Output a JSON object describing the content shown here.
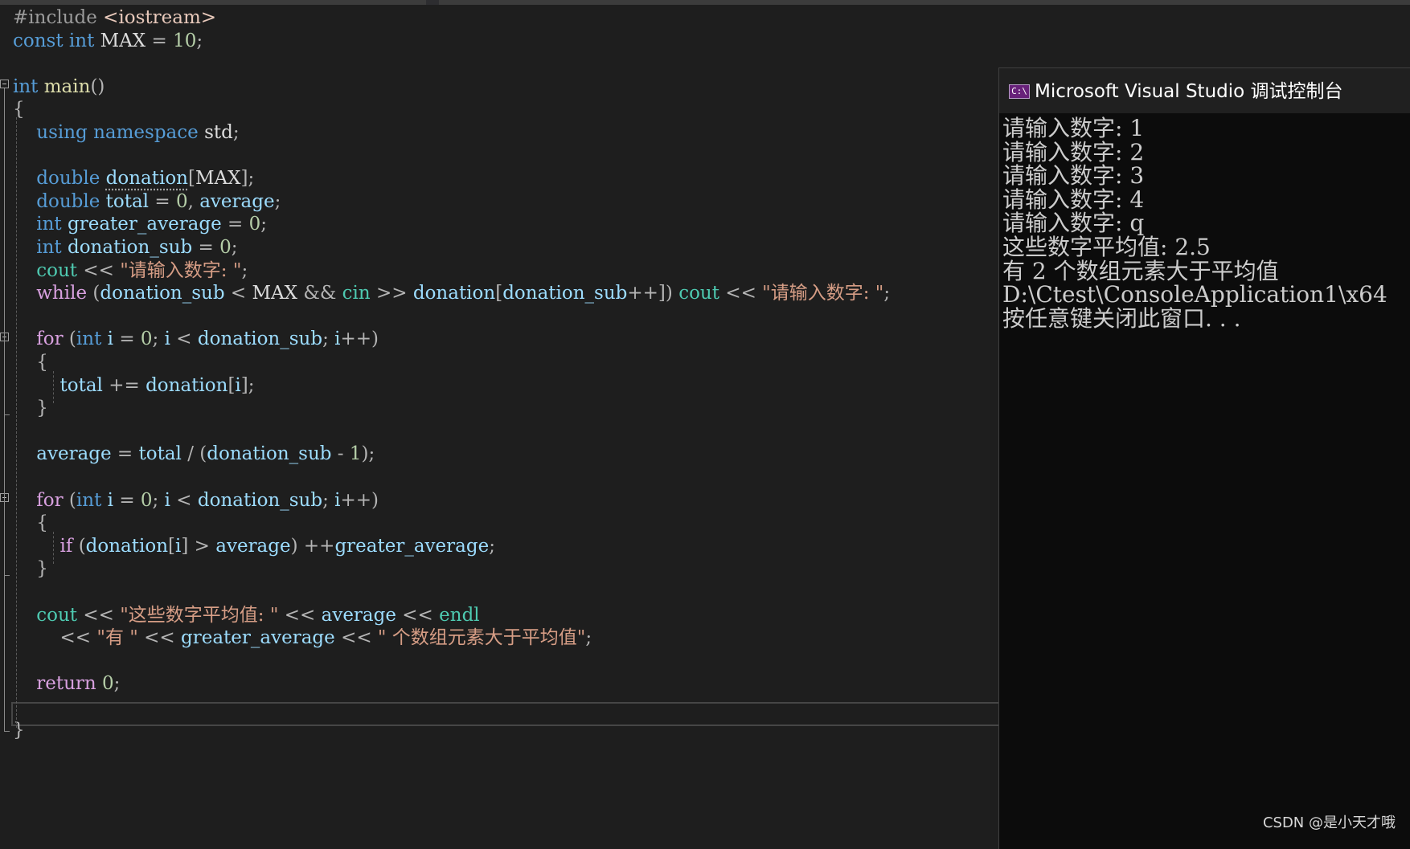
{
  "code": [
    [
      [
        "pp",
        "#include "
      ],
      [
        "inc",
        "<iostream>"
      ]
    ],
    [
      [
        "kw",
        "const "
      ],
      [
        "ty",
        "int "
      ],
      [
        "id",
        "MAX "
      ],
      [
        "op",
        "= "
      ],
      [
        "num",
        "10"
      ],
      [
        "op",
        ";"
      ]
    ],
    [],
    [
      [
        "ty",
        "int "
      ],
      [
        "fn",
        "main"
      ],
      [
        "op",
        "()"
      ]
    ],
    [
      [
        "op",
        "{"
      ]
    ],
    [
      [
        "id",
        "    "
      ],
      [
        "kw",
        "using "
      ],
      [
        "kw",
        "namespace "
      ],
      [
        "id",
        "std"
      ],
      [
        "op",
        ";"
      ]
    ],
    [],
    [
      [
        "id",
        "    "
      ],
      [
        "ty",
        "double "
      ],
      [
        "var",
        "donation"
      ],
      [
        "op",
        "["
      ],
      [
        "id",
        "MAX"
      ],
      [
        "op",
        "];"
      ]
    ],
    [
      [
        "id",
        "    "
      ],
      [
        "ty",
        "double "
      ],
      [
        "var",
        "total "
      ],
      [
        "op",
        "= "
      ],
      [
        "num",
        "0"
      ],
      [
        "op",
        ", "
      ],
      [
        "var",
        "average"
      ],
      [
        "op",
        ";"
      ]
    ],
    [
      [
        "id",
        "    "
      ],
      [
        "ty",
        "int "
      ],
      [
        "var",
        "greater_average "
      ],
      [
        "op",
        "= "
      ],
      [
        "num",
        "0"
      ],
      [
        "op",
        ";"
      ]
    ],
    [
      [
        "id",
        "    "
      ],
      [
        "ty",
        "int "
      ],
      [
        "var",
        "donation_sub "
      ],
      [
        "op",
        "= "
      ],
      [
        "num",
        "0"
      ],
      [
        "op",
        ";"
      ]
    ],
    [
      [
        "id",
        "    "
      ],
      [
        "ns",
        "cout "
      ],
      [
        "op",
        "<< "
      ],
      [
        "str",
        "\"请输入数字: \""
      ],
      [
        "op",
        ";"
      ]
    ],
    [
      [
        "id",
        "    "
      ],
      [
        "ctl",
        "while "
      ],
      [
        "op",
        "("
      ],
      [
        "var",
        "donation_sub "
      ],
      [
        "op",
        "< "
      ],
      [
        "id",
        "MAX "
      ],
      [
        "op",
        "&& "
      ],
      [
        "ns",
        "cin "
      ],
      [
        "op",
        ">> "
      ],
      [
        "var",
        "donation"
      ],
      [
        "op",
        "["
      ],
      [
        "var",
        "donation_sub"
      ],
      [
        "op",
        "++]) "
      ],
      [
        "ns",
        "cout "
      ],
      [
        "op",
        "<< "
      ],
      [
        "str",
        "\"请输入数字: \""
      ],
      [
        "op",
        ";"
      ]
    ],
    [],
    [
      [
        "id",
        "    "
      ],
      [
        "ctl",
        "for "
      ],
      [
        "op",
        "("
      ],
      [
        "ty",
        "int "
      ],
      [
        "var",
        "i "
      ],
      [
        "op",
        "= "
      ],
      [
        "num",
        "0"
      ],
      [
        "op",
        "; "
      ],
      [
        "var",
        "i "
      ],
      [
        "op",
        "< "
      ],
      [
        "var",
        "donation_sub"
      ],
      [
        "op",
        "; "
      ],
      [
        "var",
        "i"
      ],
      [
        "op",
        "++)"
      ]
    ],
    [
      [
        "id",
        "    "
      ],
      [
        "op",
        "{"
      ]
    ],
    [
      [
        "id",
        "        "
      ],
      [
        "var",
        "total "
      ],
      [
        "op",
        "+= "
      ],
      [
        "var",
        "donation"
      ],
      [
        "op",
        "["
      ],
      [
        "var",
        "i"
      ],
      [
        "op",
        "];"
      ]
    ],
    [
      [
        "id",
        "    "
      ],
      [
        "op",
        "}"
      ]
    ],
    [],
    [
      [
        "id",
        "    "
      ],
      [
        "var",
        "average "
      ],
      [
        "op",
        "= "
      ],
      [
        "var",
        "total "
      ],
      [
        "op",
        "/ ("
      ],
      [
        "var",
        "donation_sub "
      ],
      [
        "op",
        "- "
      ],
      [
        "num",
        "1"
      ],
      [
        "op",
        ");"
      ]
    ],
    [],
    [
      [
        "id",
        "    "
      ],
      [
        "ctl",
        "for "
      ],
      [
        "op",
        "("
      ],
      [
        "ty",
        "int "
      ],
      [
        "var",
        "i "
      ],
      [
        "op",
        "= "
      ],
      [
        "num",
        "0"
      ],
      [
        "op",
        "; "
      ],
      [
        "var",
        "i "
      ],
      [
        "op",
        "< "
      ],
      [
        "var",
        "donation_sub"
      ],
      [
        "op",
        "; "
      ],
      [
        "var",
        "i"
      ],
      [
        "op",
        "++)"
      ]
    ],
    [
      [
        "id",
        "    "
      ],
      [
        "op",
        "{"
      ]
    ],
    [
      [
        "id",
        "        "
      ],
      [
        "ctl",
        "if "
      ],
      [
        "op",
        "("
      ],
      [
        "var",
        "donation"
      ],
      [
        "op",
        "["
      ],
      [
        "var",
        "i"
      ],
      [
        "op",
        "] > "
      ],
      [
        "var",
        "average"
      ],
      [
        "op",
        ") ++"
      ],
      [
        "var",
        "greater_average"
      ],
      [
        "op",
        ";"
      ]
    ],
    [
      [
        "id",
        "    "
      ],
      [
        "op",
        "}"
      ]
    ],
    [],
    [
      [
        "id",
        "    "
      ],
      [
        "ns",
        "cout "
      ],
      [
        "op",
        "<< "
      ],
      [
        "str",
        "\"这些数字平均值: \" "
      ],
      [
        "op",
        "<< "
      ],
      [
        "var",
        "average "
      ],
      [
        "op",
        "<< "
      ],
      [
        "ns",
        "endl"
      ]
    ],
    [
      [
        "id",
        "        "
      ],
      [
        "op",
        "<< "
      ],
      [
        "str",
        "\"有 \" "
      ],
      [
        "op",
        "<< "
      ],
      [
        "var",
        "greater_average "
      ],
      [
        "op",
        "<< "
      ],
      [
        "str",
        "\" 个数组元素大于平均值\""
      ],
      [
        "op",
        ";"
      ]
    ],
    [],
    [
      [
        "id",
        "    "
      ],
      [
        "ctl",
        "return "
      ],
      [
        "num",
        "0"
      ],
      [
        "op",
        ";"
      ]
    ],
    [],
    [
      [
        "op",
        "}"
      ]
    ]
  ],
  "console": {
    "window_title": "Microsoft Visual Studio 调试控制台",
    "icon_text": "C:\\",
    "output_lines": [
      "请输入数字: 1",
      "请输入数字: 2",
      "请输入数字: 3",
      "请输入数字: 4",
      "请输入数字: q",
      "这些数字平均值: 2.5",
      "有 2 个数组元素大于平均值",
      "D:\\Ctest\\ConsoleApplication1\\x64",
      "按任意键关闭此窗口. . ."
    ]
  },
  "watermark": "CSDN @是小天才哦",
  "colors": {
    "editor_bg": "#1e1e1e",
    "keyword": "#569cd6",
    "control": "#d8a0df",
    "string": "#d69d85",
    "number": "#b5cea8",
    "variable": "#9cdcfe",
    "console_bg": "#0c0c0c"
  }
}
